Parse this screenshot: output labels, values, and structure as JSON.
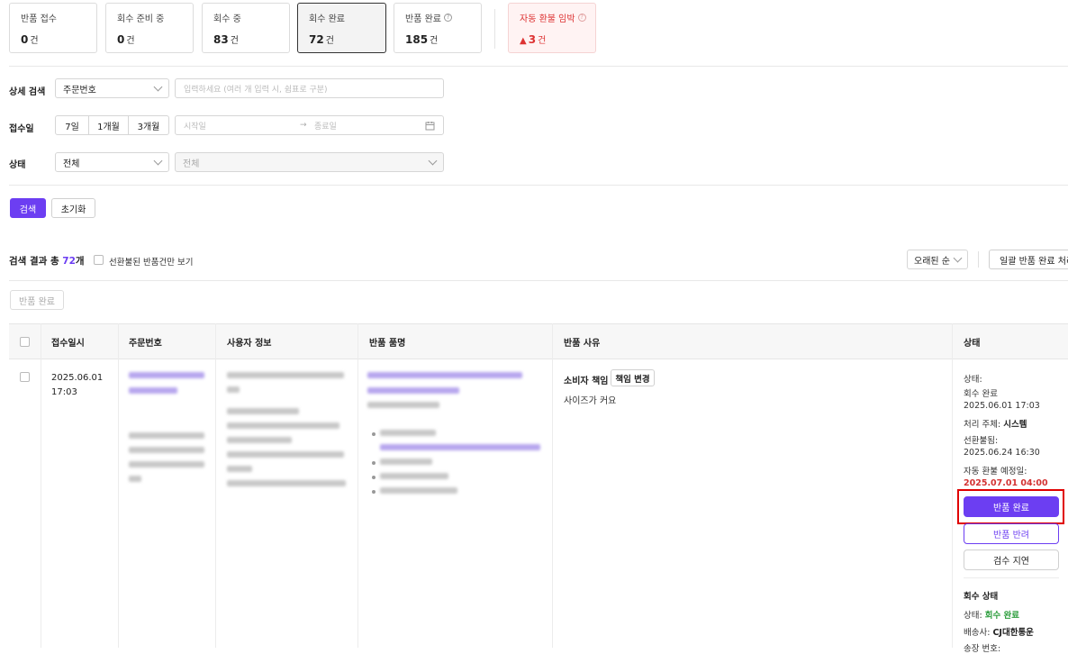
{
  "summary_cards": [
    {
      "label": "반품 접수",
      "count": "0",
      "unit": "건"
    },
    {
      "label": "회수 준비 중",
      "count": "0",
      "unit": "건"
    },
    {
      "label": "회수 중",
      "count": "83",
      "unit": "건"
    },
    {
      "label": "회수 완료",
      "count": "72",
      "unit": "건"
    },
    {
      "label": "반품 완료",
      "count": "185",
      "unit": "건"
    },
    {
      "label": "자동 환불 임박",
      "count": "3",
      "unit": "건",
      "prefix": "▲"
    }
  ],
  "filters": {
    "detail_label": "상세 검색",
    "detail_select": "주문번호",
    "detail_placeholder": "입력하세요 (여러 개 입력 시, 쉼표로 구분)",
    "date_label": "접수일",
    "date_ranges": [
      "7일",
      "1개월",
      "3개월"
    ],
    "date_start_placeholder": "시작일",
    "date_arrow": "→",
    "date_end_placeholder": "종료일",
    "status_label": "상태",
    "status_select": "전체",
    "status_sub_select": "전체",
    "search_button": "검색",
    "reset_button": "초기화"
  },
  "results": {
    "prefix": "검색 결과 총 ",
    "count": "72",
    "suffix": "개",
    "checkbox_label": "선환불된 반품건만 보기",
    "sort": "오래된 순",
    "bulk_button": "일괄 반품 완료 처리",
    "complete_button": "반품 완료"
  },
  "table": {
    "headers": [
      "접수일시",
      "주문번호",
      "사용자 정보",
      "반품 품명",
      "반품 사유",
      "상태"
    ],
    "row": {
      "date": "2025.06.01",
      "time": "17:03",
      "reason_type": "소비자 책임",
      "reason_change_button": "책임 변경",
      "reason_text": "사이즈가 커요",
      "status_label": "상태:",
      "status_value": "회수 완료",
      "status_time": "2025.06.01 17:03",
      "handler_label": "처리 주체:",
      "handler_value": "시스템",
      "prerefund_label": "선환불됨:",
      "prerefund_time": "2025.06.24 16:30",
      "auto_refund_label": "자동 환불 예정일:",
      "auto_refund_date": "2025.07.01 04:00",
      "complete_button": "반품 완료",
      "reject_button": "반품 반려",
      "delay_button": "검수 지연",
      "pickup_title": "회수 상태",
      "pickup_status_label": "상태:",
      "pickup_status_value": "회수 완료",
      "carrier_label": "배송사:",
      "carrier_value": "CJ대한통운",
      "tracking_label": "송장 번호:"
    }
  },
  "colors": {
    "accent": "#6c3ef2",
    "danger": "#d33333",
    "success": "#2e9e3e",
    "highlight_box": "#e00000"
  }
}
